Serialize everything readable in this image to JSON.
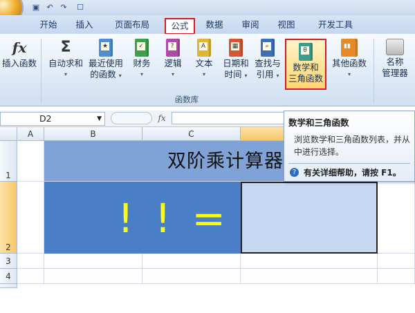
{
  "colors": {
    "accent_red": "#d71920",
    "title_band": "#7fa3d6",
    "formula_band": "#4a7fc8",
    "formula_text": "#ffff00",
    "result_cell": "#c5d7f1"
  },
  "tabs": [
    "开始",
    "插入",
    "页面布局",
    "公式",
    "数据",
    "审阅",
    "视图",
    "开发工具"
  ],
  "active_tab": "公式",
  "ribbon": {
    "insert_function": {
      "symbol": "fx",
      "label": "插入函数"
    },
    "autosum": {
      "symbol": "Σ",
      "line1": "自动求和",
      "caret": "▾"
    },
    "recent": {
      "line1": "最近使用",
      "line2": "的函数",
      "caret": "▾"
    },
    "finance": {
      "line1": "财务",
      "caret": "▾"
    },
    "logic": {
      "line1": "逻辑",
      "caret": "▾"
    },
    "text": {
      "line1": "文本",
      "caret": "▾"
    },
    "datetime": {
      "line1": "日期和",
      "line2": "时间",
      "caret": "▾"
    },
    "lookup": {
      "line1": "查找与",
      "line2": "引用",
      "caret": "▾"
    },
    "math": {
      "line1": "数学和",
      "line2": "三角函数"
    },
    "other": {
      "line1": "其他函数",
      "caret": "▾"
    },
    "name_manager": {
      "line1": "名称",
      "line2": "管理器"
    },
    "group_label": "函数库"
  },
  "formula_bar": {
    "name_box": "D2",
    "fx": "fx"
  },
  "grid": {
    "columns": [
      "A",
      "B",
      "C"
    ],
    "rows": [
      "1",
      "2",
      "3",
      "4"
    ],
    "title": "双阶乘计算器",
    "formula": "! ! ="
  },
  "tooltip": {
    "title": "数学和三角函数",
    "body": "浏览数学和三角函数列表，并从中进行选择。",
    "help": "有关详细帮助，请按 F1。"
  }
}
